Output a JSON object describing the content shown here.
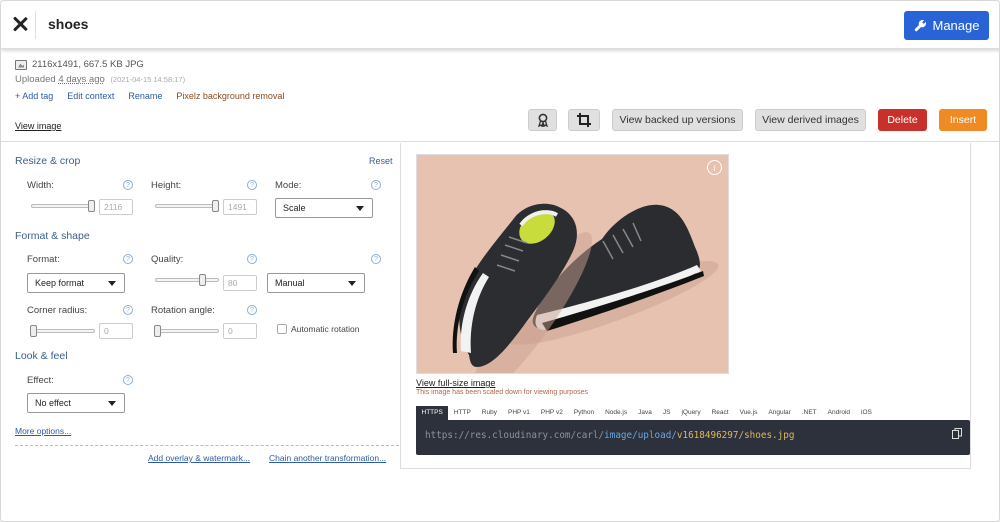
{
  "header": {
    "title": "shoes",
    "manage_label": "Manage"
  },
  "info": {
    "meta": "2116x1491, 667.5 KB JPG",
    "uploaded_prefix": "Uploaded",
    "uploaded_ago": "4 days ago",
    "uploaded_timestamp": "(2021-04-15 14:58:17)",
    "links": [
      "+ Add tag",
      "Edit context",
      "Rename",
      "Pixelz background removal"
    ],
    "view_image": "View image"
  },
  "toolbar": {
    "view_backed_up": "View backed up versions",
    "view_derived": "View derived images",
    "delete": "Delete",
    "insert": "Insert"
  },
  "left": {
    "resize_title": "Resize & crop",
    "reset": "Reset",
    "width_label": "Width:",
    "width_value": "2116",
    "height_label": "Height:",
    "height_value": "1491",
    "mode_label": "Mode:",
    "mode_value": "Scale",
    "format_title": "Format & shape",
    "format_label": "Format:",
    "format_value": "Keep format",
    "quality_label": "Quality:",
    "quality_value": "80",
    "quality_mode": "Manual",
    "corner_label": "Corner radius:",
    "corner_value": "0",
    "rotation_label": "Rotation angle:",
    "rotation_value": "0",
    "auto_rotation": "Automatic rotation",
    "look_title": "Look & feel",
    "effect_label": "Effect:",
    "effect_value": "No effect",
    "more_options": "More options...",
    "add_overlay": "Add overlay & watermark...",
    "chain_transform": "Chain another transformation..."
  },
  "right": {
    "view_full": "View full-size image",
    "scaled_note": "This image has been scaled down for viewing purposes",
    "code_tabs": [
      "HTTPS",
      "HTTP",
      "Ruby",
      "PHP v1",
      "PHP v2",
      "Python",
      "Node.js",
      "Java",
      "JS",
      "jQuery",
      "React",
      "Vue.js",
      "Angular",
      ".NET",
      "Android",
      "iOS"
    ],
    "url_base": "https://res.cloudinary.com/carl/",
    "url_mid": "image/upload/",
    "url_version": "v1618496297/",
    "url_file": "shoes.jpg"
  },
  "colors": {
    "manage": "#2864d8",
    "delete": "#c8302b",
    "insert": "#ef8a25",
    "link": "#2d5aa0"
  }
}
